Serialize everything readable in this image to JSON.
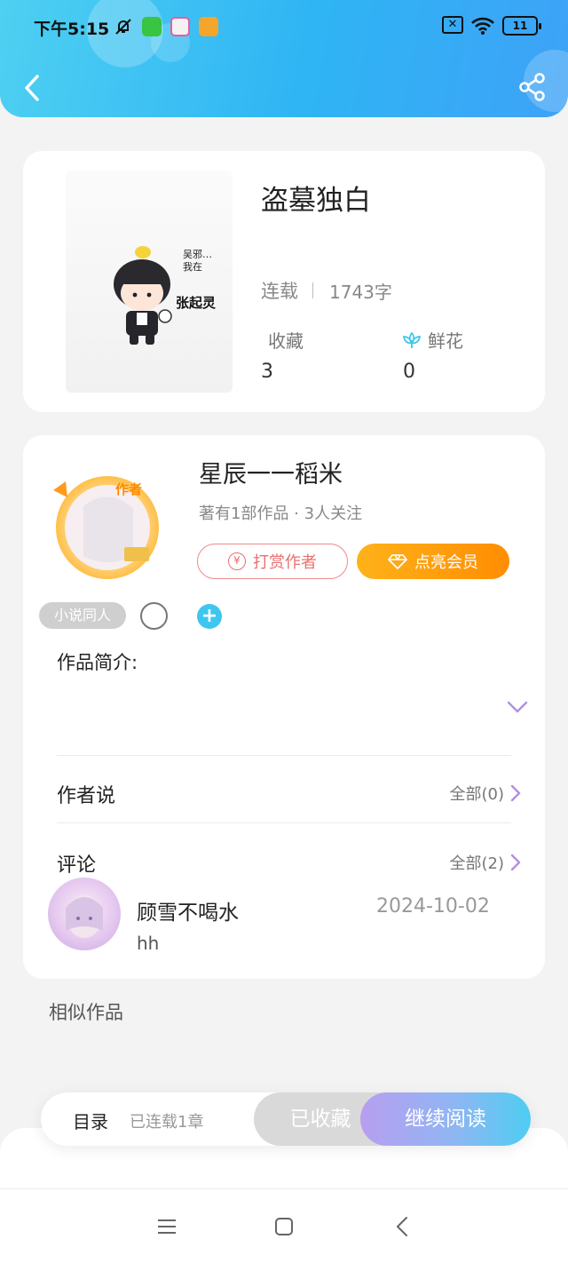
{
  "status_bar": {
    "time": "下午5:15",
    "battery": "11"
  },
  "book": {
    "title": "盗墓独白",
    "status": "连载",
    "word_count": "1743字",
    "favorites_label": "收藏",
    "favorites_value": "3",
    "flowers_label": "鲜花",
    "flowers_value": "0",
    "cover_text_1": "吴邪…",
    "cover_text_2": "我在",
    "cover_text_3": "张起灵"
  },
  "author": {
    "name": "星辰一一稻米",
    "stats": "著有1部作品 · 3人关注",
    "badge": "作者",
    "reward_label": "打赏作者",
    "vip_label": "点亮会员",
    "tag": "小说同人"
  },
  "intro": {
    "label": "作品简介:"
  },
  "author_says": {
    "title": "作者说",
    "all_label": "全部(0)"
  },
  "comments": {
    "title": "评论",
    "all_label": "全部(2)",
    "items": [
      {
        "user": "顾雪不喝水",
        "date": "2024-10-02",
        "text": "hh"
      }
    ]
  },
  "similar": {
    "title": "相似作品"
  },
  "action_bar": {
    "toc_label": "目录",
    "chapter_count": "已连载1章",
    "collected_label": "已收藏",
    "continue_label": "继续阅读"
  },
  "colors": {
    "header_start": "#4ed0f2",
    "header_end": "#3ea2f7",
    "reward": "#e9706f",
    "vip": "#ff8d02",
    "accent": "#3ec6ef",
    "chevron": "#b58ee0"
  }
}
